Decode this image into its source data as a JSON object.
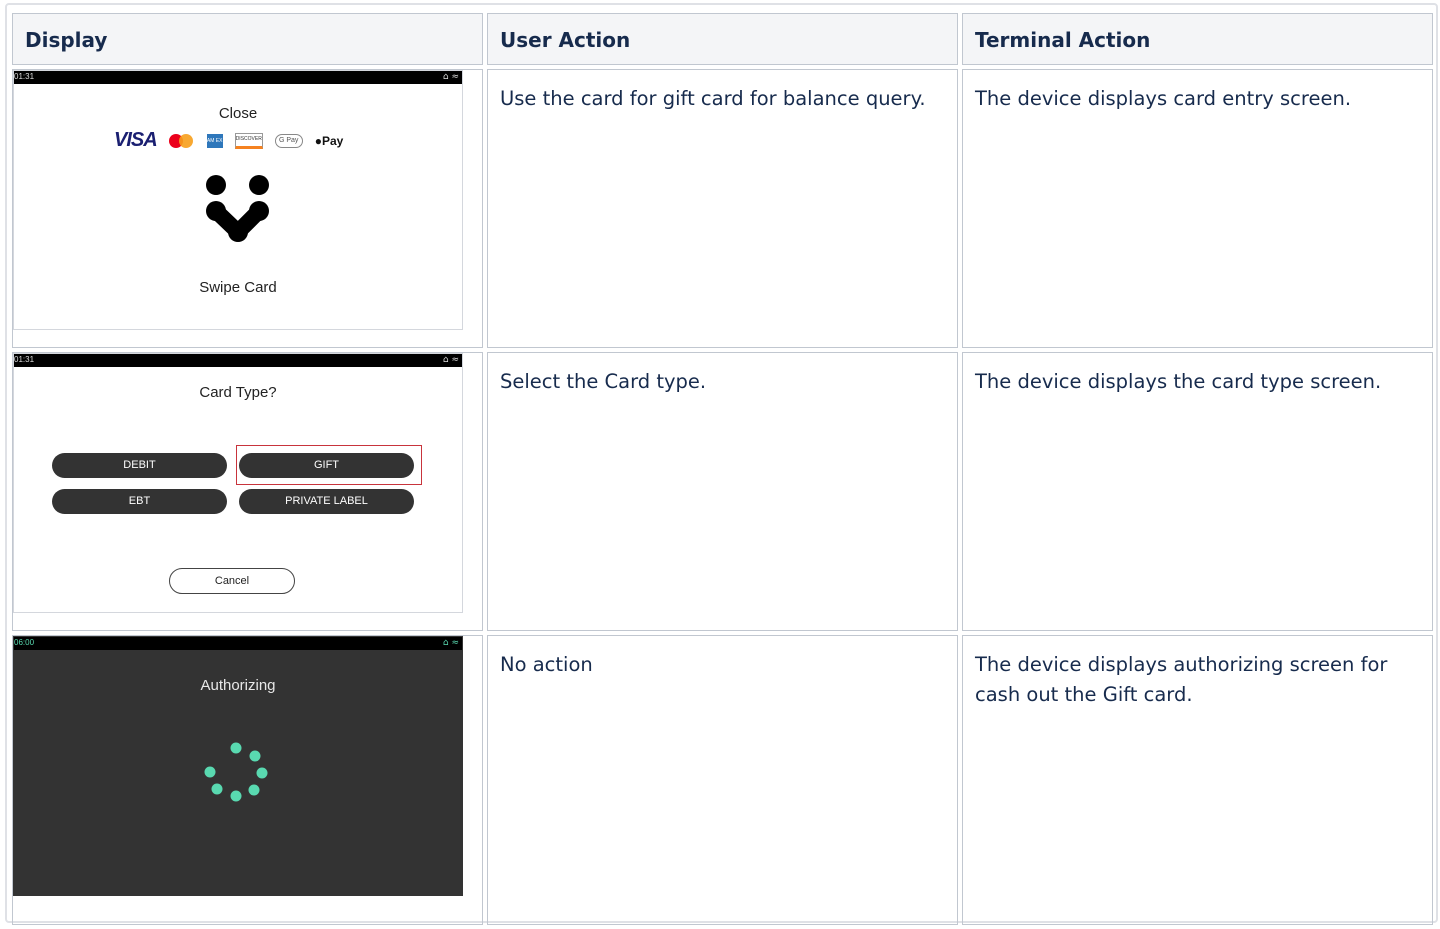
{
  "headers": {
    "display": "Display",
    "user_action": "User Action",
    "terminal_action": "Terminal Action"
  },
  "rows": [
    {
      "screen": {
        "time": "01:31",
        "title": "Close",
        "brands": {
          "visa": "VISA",
          "amex": "AM EX",
          "discover": "DISCOVER",
          "gpay": "G Pay",
          "applepay": "Pay"
        },
        "subtitle": "Swipe Card"
      },
      "user_action": "Use the card for gift card for balance query.",
      "terminal_action": "The device displays card entry screen."
    },
    {
      "screen": {
        "time": "01:31",
        "title": "Card Type?",
        "buttons": {
          "debit": "DEBIT",
          "gift": "GIFT",
          "ebt": "EBT",
          "private_label": "PRIVATE LABEL"
        },
        "cancel": "Cancel"
      },
      "user_action": "Select the Card type.",
      "terminal_action": "The device displays the card type screen."
    },
    {
      "screen": {
        "time": "06:00",
        "title": "Authorizing"
      },
      "user_action": "No action",
      "terminal_action": "The device displays authorizing screen for cash out the Gift card."
    }
  ],
  "colors": {
    "header_bg": "#f4f5f7",
    "border": "#c1c7d0",
    "spinner": "#59d9b0",
    "highlight": "#c8343c",
    "dark_screen": "#333333"
  }
}
